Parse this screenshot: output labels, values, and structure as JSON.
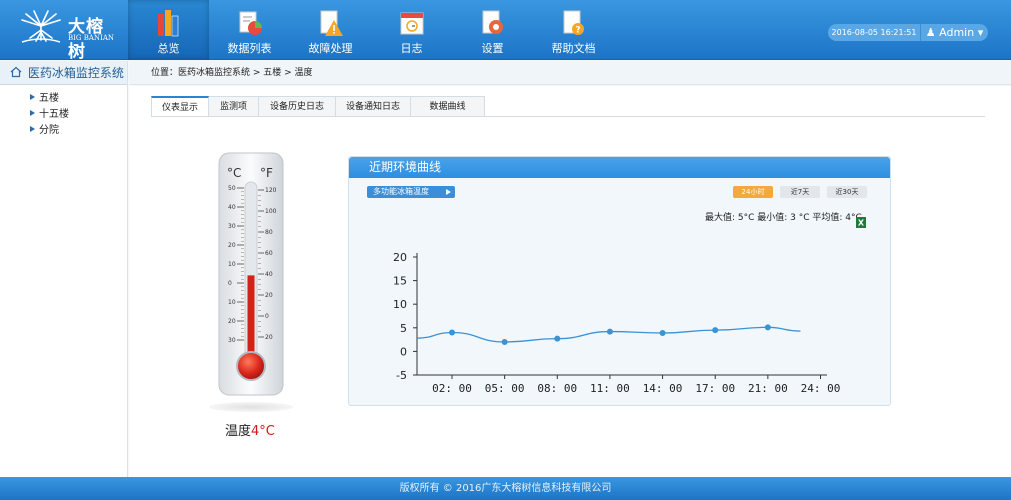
{
  "brand": {
    "name": "大榕树",
    "sub": "BIG BANIAN",
    "color": "#1c74c6"
  },
  "nav": [
    {
      "label": "总览",
      "icon": "books-icon",
      "active": true
    },
    {
      "label": "数据列表",
      "icon": "data-list-icon",
      "active": false
    },
    {
      "label": "故障处理",
      "icon": "warning-icon",
      "active": false
    },
    {
      "label": "日志",
      "icon": "calendar-icon",
      "active": false
    },
    {
      "label": "设置",
      "icon": "gear-icon",
      "active": false
    },
    {
      "label": "帮助文档",
      "icon": "help-doc-icon",
      "active": false
    }
  ],
  "header": {
    "datetime": "2016-08-05 16:21:51",
    "user": "Admin"
  },
  "sidebar": {
    "title": "医药冰箱监控系统",
    "items": [
      {
        "label": "五楼"
      },
      {
        "label": "十五楼"
      },
      {
        "label": "分院"
      }
    ]
  },
  "breadcrumb": "位置：医药冰箱监控系统 > 五楼 > 温度",
  "tabs": [
    {
      "label": "仪表显示",
      "active": true
    },
    {
      "label": "监测项",
      "active": false
    },
    {
      "label": "设备历史日志",
      "active": false
    },
    {
      "label": "设备通知日志",
      "active": false
    },
    {
      "label": "数据曲线",
      "active": false
    }
  ],
  "thermometer": {
    "celsius_unit": "°C",
    "fahrenheit_unit": "°F",
    "c_ticks": [
      "50",
      "40",
      "30",
      "20",
      "10",
      "0",
      "10",
      "20",
      "30"
    ],
    "f_ticks": [
      "120",
      "100",
      "80",
      "60",
      "40",
      "20",
      "0",
      "20"
    ],
    "value": 4
  },
  "temperature": {
    "label": "温度",
    "value": "4°C"
  },
  "panel": {
    "title": "近期环境曲线",
    "series_button": "多功能冰箱温度",
    "ranges": [
      {
        "label": "24小时",
        "active": true
      },
      {
        "label": "近7天",
        "active": false
      },
      {
        "label": "近30天",
        "active": false
      }
    ],
    "stats": "最大值: 5°C   最小值: 3 °C   平均值: 4°C"
  },
  "chart_data": {
    "type": "line",
    "x": [
      "02:00",
      "05:00",
      "08:00",
      "11:00",
      "14:00",
      "17:00",
      "21:00",
      "24:00"
    ],
    "series": [
      {
        "values": [
          4,
          2,
          2.7,
          4.2,
          3.9,
          4.5,
          5.1
        ]
      }
    ],
    "y_ticks": [
      20,
      15,
      10,
      5,
      0,
      -5
    ],
    "ylim": [
      -5,
      20
    ],
    "line_color": "#3a93d6"
  },
  "footer": "版权所有 © 2016广东大榕树信息科技有限公司"
}
